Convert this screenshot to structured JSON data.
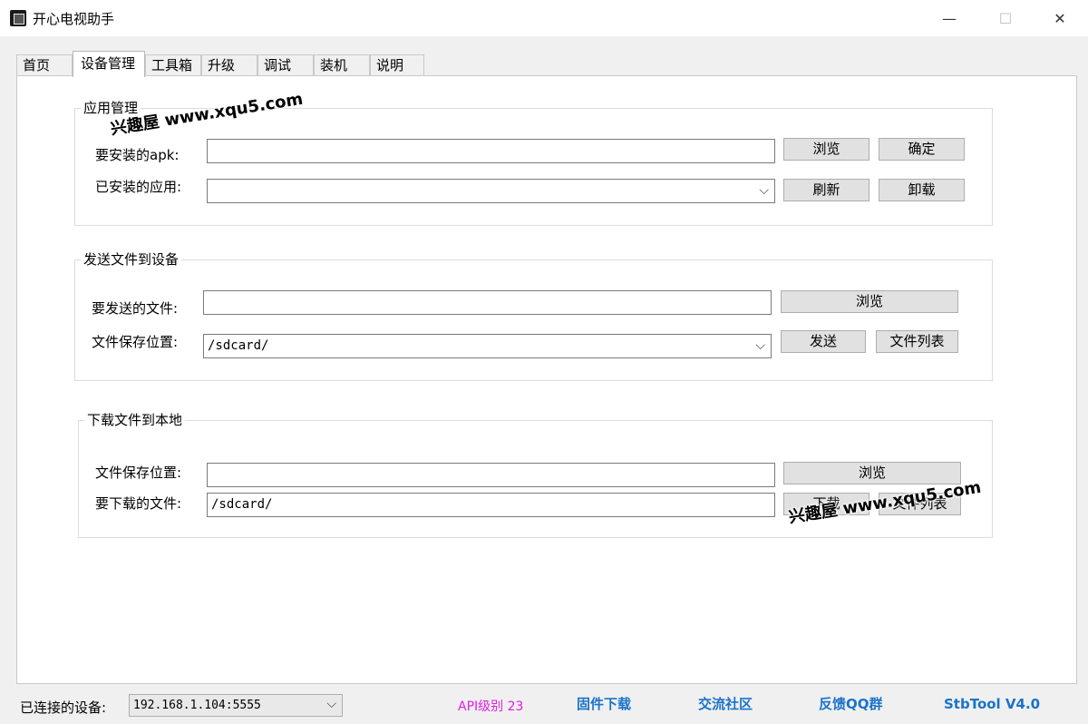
{
  "window": {
    "title": "开心电视助手",
    "min_glyph": "—",
    "max_glyph": "☐",
    "close_glyph": "✕"
  },
  "tabs": [
    {
      "label": "首页"
    },
    {
      "label": "设备管理",
      "active": true
    },
    {
      "label": "工具箱"
    },
    {
      "label": "升级"
    },
    {
      "label": "调试"
    },
    {
      "label": "装机"
    },
    {
      "label": "说明"
    }
  ],
  "app_management": {
    "title": "应用管理",
    "apk_label": "要安装的apk:",
    "apk_value": "",
    "browse_label": "浏览",
    "confirm_label": "确定",
    "installed_label": "已安装的应用:",
    "installed_value": "",
    "refresh_label": "刷新",
    "uninstall_label": "卸载"
  },
  "send_files": {
    "title": "发送文件到设备",
    "file_label": "要发送的文件:",
    "file_value": "",
    "browse_label": "浏览",
    "save_label": "文件保存位置:",
    "save_value": "/sdcard/",
    "send_label": "发送",
    "list_label": "文件列表"
  },
  "download_files": {
    "title": "下载文件到本地",
    "save_label": "文件保存位置:",
    "save_value": "",
    "browse_label": "浏览",
    "file_label": "要下载的文件:",
    "file_value": "/sdcard/",
    "download_label": "下载",
    "list_label": "文件列表"
  },
  "watermark": {
    "text": "兴趣屋 www.xqu5.com"
  },
  "status": {
    "device_label": "已连接的设备:",
    "device_value": "192.168.1.104:5555",
    "api_level": "API级别 23",
    "firmware_link": "固件下载",
    "community_link": "交流社区",
    "feedback_link": "反馈QQ群",
    "version": "StbTool V4.0"
  },
  "colors": {
    "link": "#1a73c9",
    "api_text": "#e020e0",
    "panel_bg": "#ffffff",
    "window_bg": "#f0f0f0"
  },
  "icons": {
    "dropdown": "chevron-down-icon",
    "app": "app-icon"
  }
}
